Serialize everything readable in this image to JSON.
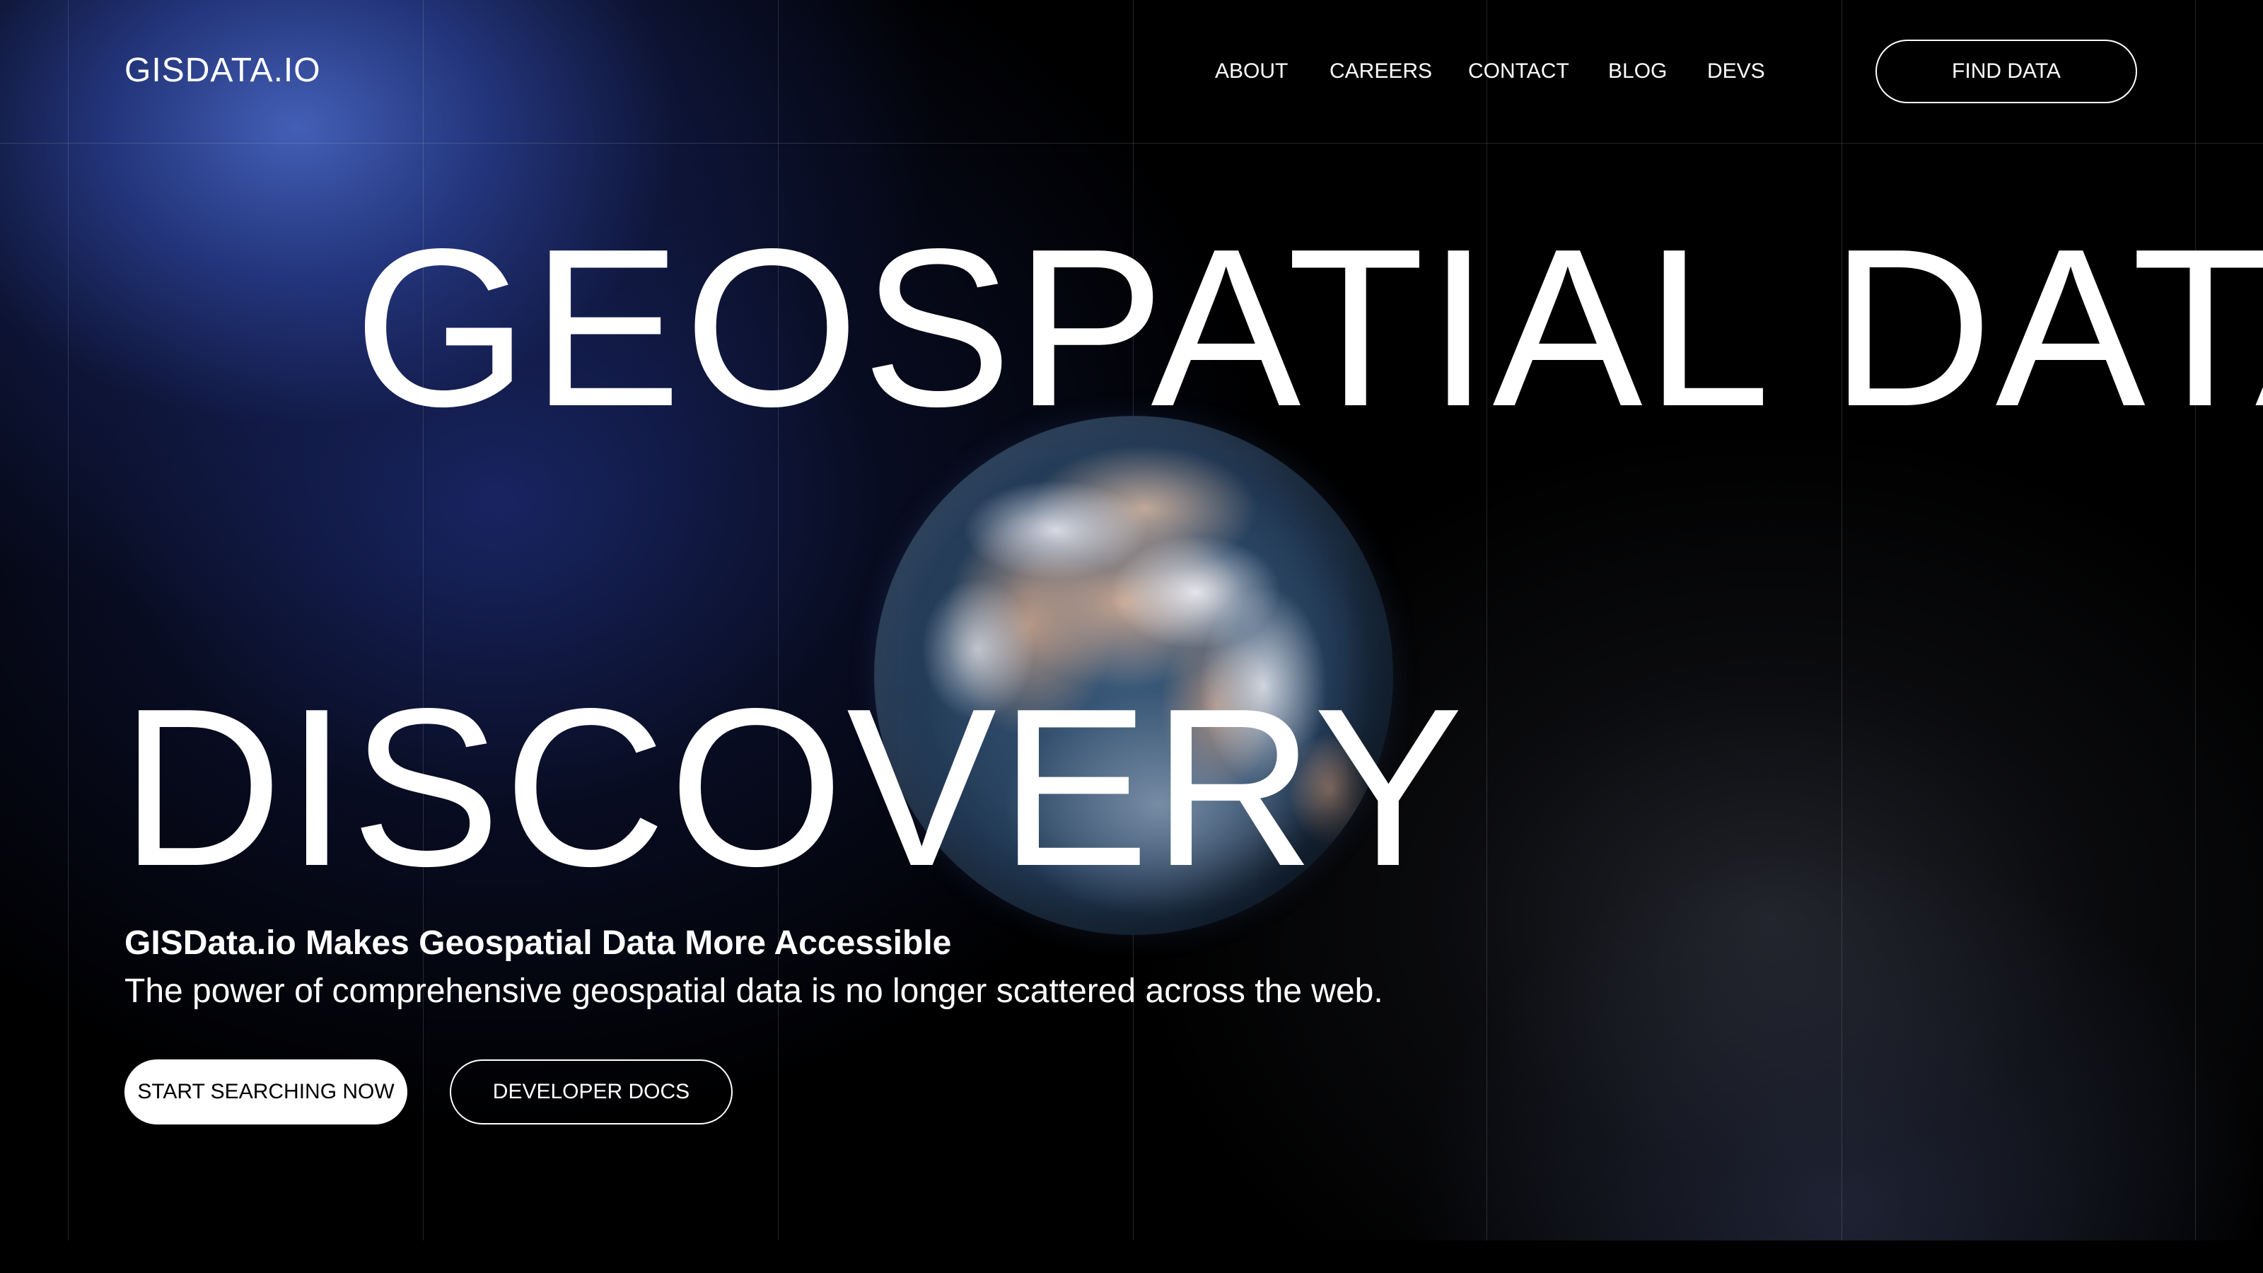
{
  "header": {
    "logo": "GISDATA.IO",
    "nav": [
      {
        "label": "ABOUT"
      },
      {
        "label": "CAREERS"
      },
      {
        "label": "CONTACT"
      },
      {
        "label": "BLOG"
      },
      {
        "label": "DEVS"
      }
    ],
    "cta": "FIND DATA"
  },
  "hero": {
    "title_line1": "GEOSPATIAL DATA",
    "title_line2": "DISCOVERY",
    "subheading": "GISData.io Makes Geospatial Data More Accessible",
    "description": "The power of comprehensive geospatial data is no longer scattered across the web.",
    "primary_button": "START SEARCHING NOW",
    "secondary_button": "DEVELOPER DOCS"
  },
  "colors": {
    "background": "#000000",
    "accent_blue": "#2c4591",
    "text": "#ffffff"
  }
}
